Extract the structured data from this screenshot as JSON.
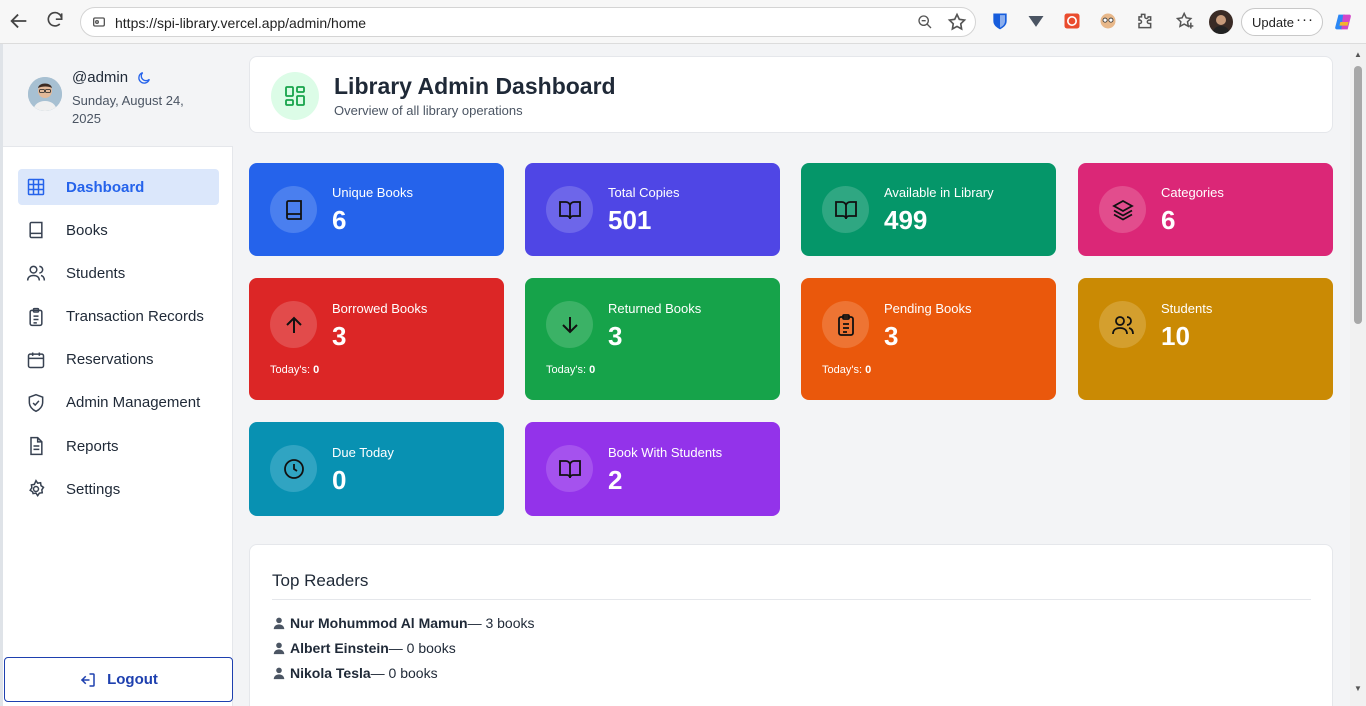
{
  "browser": {
    "url": "https://spi-library.vercel.app/admin/home",
    "update_label": "Update",
    "more_label": "···"
  },
  "sidebar": {
    "username": "@admin",
    "date": "Sunday, August 24, 2025",
    "items": [
      {
        "label": "Dashboard",
        "icon": "grid-icon",
        "active": true
      },
      {
        "label": "Books",
        "icon": "book-icon"
      },
      {
        "label": "Students",
        "icon": "users-icon"
      },
      {
        "label": "Transaction Records",
        "icon": "clipboard-icon"
      },
      {
        "label": "Reservations",
        "icon": "calendar-icon"
      },
      {
        "label": "Admin Management",
        "icon": "shield-icon"
      },
      {
        "label": "Reports",
        "icon": "file-icon"
      },
      {
        "label": "Settings",
        "icon": "gear-icon"
      }
    ],
    "logout_label": "Logout"
  },
  "header": {
    "title": "Library Admin Dashboard",
    "subtitle": "Overview of all library operations"
  },
  "stats": [
    {
      "label": "Unique Books",
      "value": "6",
      "color": "#2563eb",
      "icon": "book-icon"
    },
    {
      "label": "Total Copies",
      "value": "501",
      "color": "#4f46e5",
      "icon": "open-book-icon"
    },
    {
      "label": "Available in Library",
      "value": "499",
      "color": "#059669",
      "icon": "open-book-icon"
    },
    {
      "label": "Categories",
      "value": "6",
      "color": "#db2777",
      "icon": "layers-icon"
    },
    {
      "label": "Borrowed Books",
      "value": "3",
      "color": "#dc2626",
      "icon": "arrow-up-icon",
      "today_label": "Today's:",
      "today_value": "0"
    },
    {
      "label": "Returned Books",
      "value": "3",
      "color": "#16a34a",
      "icon": "arrow-down-icon",
      "today_label": "Today's:",
      "today_value": "0"
    },
    {
      "label": "Pending Books",
      "value": "3",
      "color": "#ea580c",
      "icon": "clipboard-icon",
      "today_label": "Today's:",
      "today_value": "0"
    },
    {
      "label": "Students",
      "value": "10",
      "color": "#ca8a04",
      "icon": "users-icon"
    },
    {
      "label": "Due Today",
      "value": "0",
      "color": "#0891b2",
      "icon": "clock-icon"
    },
    {
      "label": "Book With Students",
      "value": "2",
      "color": "#9333ea",
      "icon": "open-book-icon"
    }
  ],
  "top_readers": {
    "title": "Top Readers",
    "readers": [
      {
        "name": "Nur Mohummod Al Mamun",
        "count": " — 3 books"
      },
      {
        "name": "Albert Einstein",
        "count": " — 0 books"
      },
      {
        "name": "Nikola Tesla",
        "count": " — 0 books"
      }
    ]
  }
}
